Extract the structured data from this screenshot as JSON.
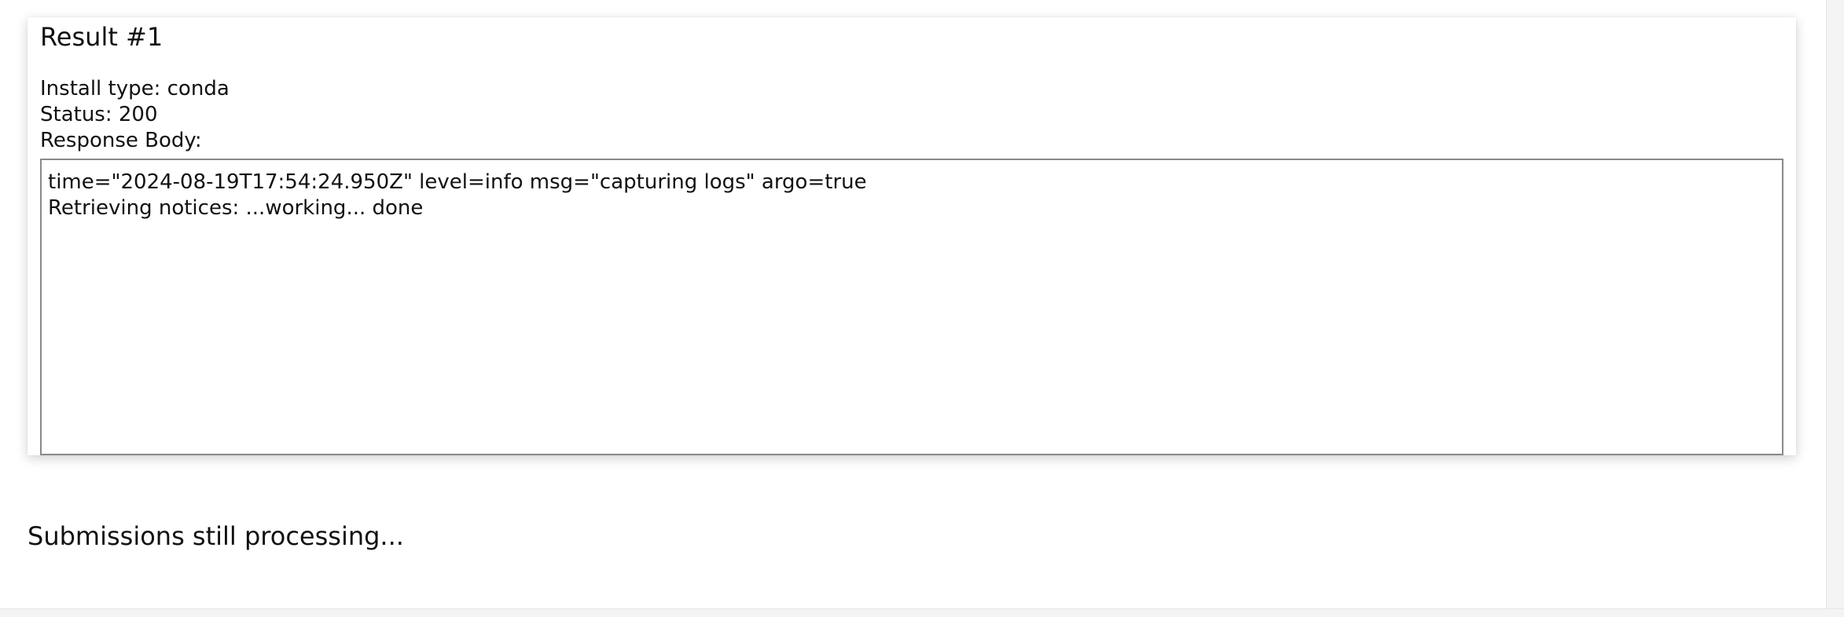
{
  "result": {
    "title": "Result #1",
    "install_type": "Install type: conda",
    "status": "Status: 200",
    "response_body_label": "Response Body:",
    "response_lines": [
      "time=\"2024-08-19T17:54:24.950Z\" level=info msg=\"capturing logs\" argo=true",
      "Retrieving notices: ...working... done"
    ]
  },
  "footer": {
    "processing_message": "Submissions still processing..."
  }
}
